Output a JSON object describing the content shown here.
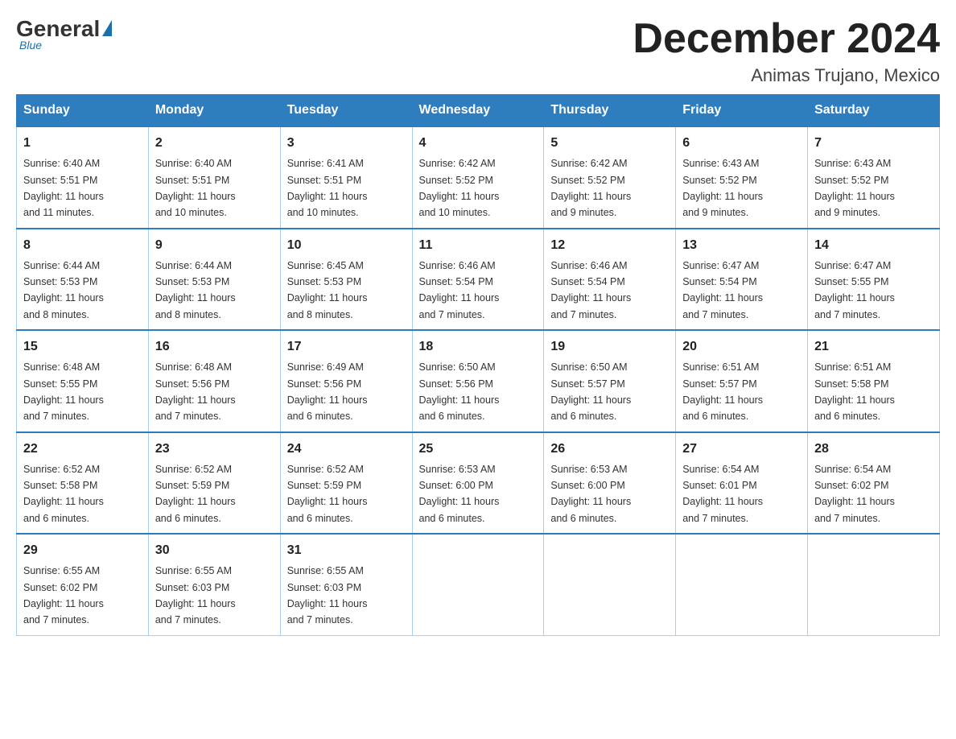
{
  "header": {
    "logo_general": "General",
    "logo_blue": "Blue",
    "month_title": "December 2024",
    "location": "Animas Trujano, Mexico"
  },
  "days_of_week": [
    "Sunday",
    "Monday",
    "Tuesday",
    "Wednesday",
    "Thursday",
    "Friday",
    "Saturday"
  ],
  "weeks": [
    [
      {
        "day": "1",
        "sunrise": "6:40 AM",
        "sunset": "5:51 PM",
        "daylight": "11 hours and 11 minutes."
      },
      {
        "day": "2",
        "sunrise": "6:40 AM",
        "sunset": "5:51 PM",
        "daylight": "11 hours and 10 minutes."
      },
      {
        "day": "3",
        "sunrise": "6:41 AM",
        "sunset": "5:51 PM",
        "daylight": "11 hours and 10 minutes."
      },
      {
        "day": "4",
        "sunrise": "6:42 AM",
        "sunset": "5:52 PM",
        "daylight": "11 hours and 10 minutes."
      },
      {
        "day": "5",
        "sunrise": "6:42 AM",
        "sunset": "5:52 PM",
        "daylight": "11 hours and 9 minutes."
      },
      {
        "day": "6",
        "sunrise": "6:43 AM",
        "sunset": "5:52 PM",
        "daylight": "11 hours and 9 minutes."
      },
      {
        "day": "7",
        "sunrise": "6:43 AM",
        "sunset": "5:52 PM",
        "daylight": "11 hours and 9 minutes."
      }
    ],
    [
      {
        "day": "8",
        "sunrise": "6:44 AM",
        "sunset": "5:53 PM",
        "daylight": "11 hours and 8 minutes."
      },
      {
        "day": "9",
        "sunrise": "6:44 AM",
        "sunset": "5:53 PM",
        "daylight": "11 hours and 8 minutes."
      },
      {
        "day": "10",
        "sunrise": "6:45 AM",
        "sunset": "5:53 PM",
        "daylight": "11 hours and 8 minutes."
      },
      {
        "day": "11",
        "sunrise": "6:46 AM",
        "sunset": "5:54 PM",
        "daylight": "11 hours and 7 minutes."
      },
      {
        "day": "12",
        "sunrise": "6:46 AM",
        "sunset": "5:54 PM",
        "daylight": "11 hours and 7 minutes."
      },
      {
        "day": "13",
        "sunrise": "6:47 AM",
        "sunset": "5:54 PM",
        "daylight": "11 hours and 7 minutes."
      },
      {
        "day": "14",
        "sunrise": "6:47 AM",
        "sunset": "5:55 PM",
        "daylight": "11 hours and 7 minutes."
      }
    ],
    [
      {
        "day": "15",
        "sunrise": "6:48 AM",
        "sunset": "5:55 PM",
        "daylight": "11 hours and 7 minutes."
      },
      {
        "day": "16",
        "sunrise": "6:48 AM",
        "sunset": "5:56 PM",
        "daylight": "11 hours and 7 minutes."
      },
      {
        "day": "17",
        "sunrise": "6:49 AM",
        "sunset": "5:56 PM",
        "daylight": "11 hours and 6 minutes."
      },
      {
        "day": "18",
        "sunrise": "6:50 AM",
        "sunset": "5:56 PM",
        "daylight": "11 hours and 6 minutes."
      },
      {
        "day": "19",
        "sunrise": "6:50 AM",
        "sunset": "5:57 PM",
        "daylight": "11 hours and 6 minutes."
      },
      {
        "day": "20",
        "sunrise": "6:51 AM",
        "sunset": "5:57 PM",
        "daylight": "11 hours and 6 minutes."
      },
      {
        "day": "21",
        "sunrise": "6:51 AM",
        "sunset": "5:58 PM",
        "daylight": "11 hours and 6 minutes."
      }
    ],
    [
      {
        "day": "22",
        "sunrise": "6:52 AM",
        "sunset": "5:58 PM",
        "daylight": "11 hours and 6 minutes."
      },
      {
        "day": "23",
        "sunrise": "6:52 AM",
        "sunset": "5:59 PM",
        "daylight": "11 hours and 6 minutes."
      },
      {
        "day": "24",
        "sunrise": "6:52 AM",
        "sunset": "5:59 PM",
        "daylight": "11 hours and 6 minutes."
      },
      {
        "day": "25",
        "sunrise": "6:53 AM",
        "sunset": "6:00 PM",
        "daylight": "11 hours and 6 minutes."
      },
      {
        "day": "26",
        "sunrise": "6:53 AM",
        "sunset": "6:00 PM",
        "daylight": "11 hours and 6 minutes."
      },
      {
        "day": "27",
        "sunrise": "6:54 AM",
        "sunset": "6:01 PM",
        "daylight": "11 hours and 7 minutes."
      },
      {
        "day": "28",
        "sunrise": "6:54 AM",
        "sunset": "6:02 PM",
        "daylight": "11 hours and 7 minutes."
      }
    ],
    [
      {
        "day": "29",
        "sunrise": "6:55 AM",
        "sunset": "6:02 PM",
        "daylight": "11 hours and 7 minutes."
      },
      {
        "day": "30",
        "sunrise": "6:55 AM",
        "sunset": "6:03 PM",
        "daylight": "11 hours and 7 minutes."
      },
      {
        "day": "31",
        "sunrise": "6:55 AM",
        "sunset": "6:03 PM",
        "daylight": "11 hours and 7 minutes."
      },
      null,
      null,
      null,
      null
    ]
  ],
  "labels": {
    "sunrise": "Sunrise:",
    "sunset": "Sunset:",
    "daylight": "Daylight:"
  }
}
